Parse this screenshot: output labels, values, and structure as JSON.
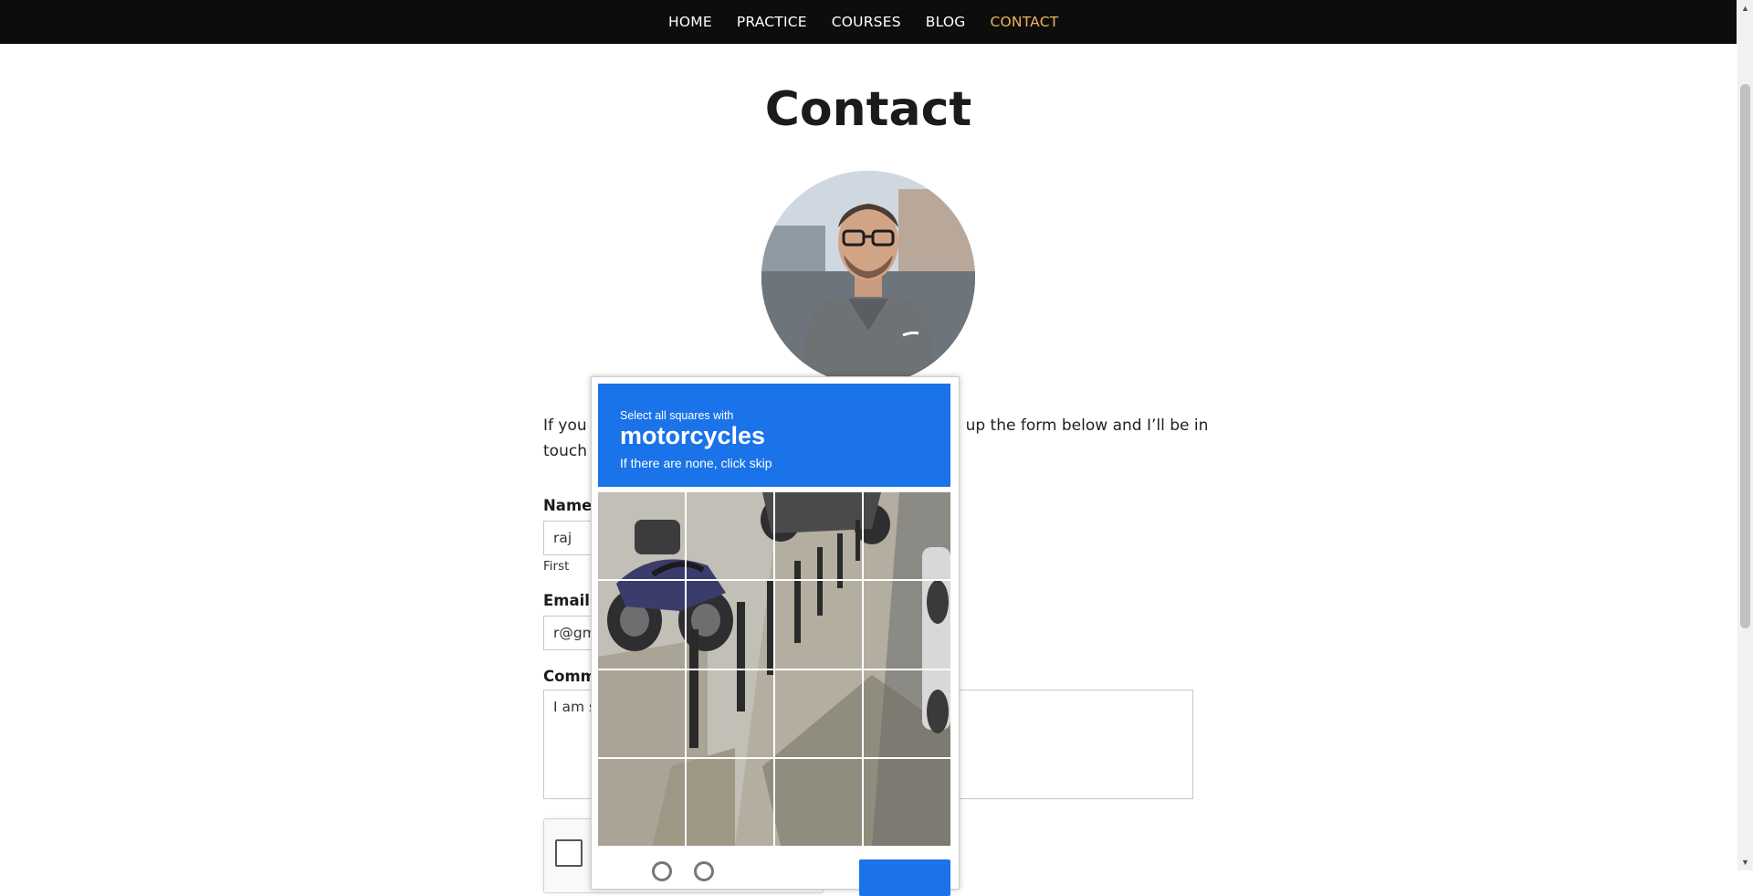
{
  "nav": {
    "items": [
      {
        "label": "HOME",
        "active": false
      },
      {
        "label": "PRACTICE",
        "active": false
      },
      {
        "label": "COURSES",
        "active": false
      },
      {
        "label": "BLOG",
        "active": false
      },
      {
        "label": "CONTACT",
        "active": true
      }
    ],
    "active_color": "#f0b35a"
  },
  "page": {
    "title": "Contact",
    "intro_line1_left": "If you h",
    "intro_line1_right": "ill up the form below and I’ll be in",
    "intro_line2_left": "touch a"
  },
  "form": {
    "name_label": "Name",
    "name_required": "*",
    "name_value": "raj",
    "name_sublabel": "First",
    "email_label": "Email",
    "email_required": "*",
    "email_value": "r@gm",
    "comment_label": "Comme",
    "comment_value": "I am s"
  },
  "captcha": {
    "instruction_small": "Select all squares with",
    "target": "motorcycles",
    "hint": "If there are none, click skip",
    "grid_rows": 4,
    "grid_cols": 4,
    "header_color": "#1a73e8"
  }
}
